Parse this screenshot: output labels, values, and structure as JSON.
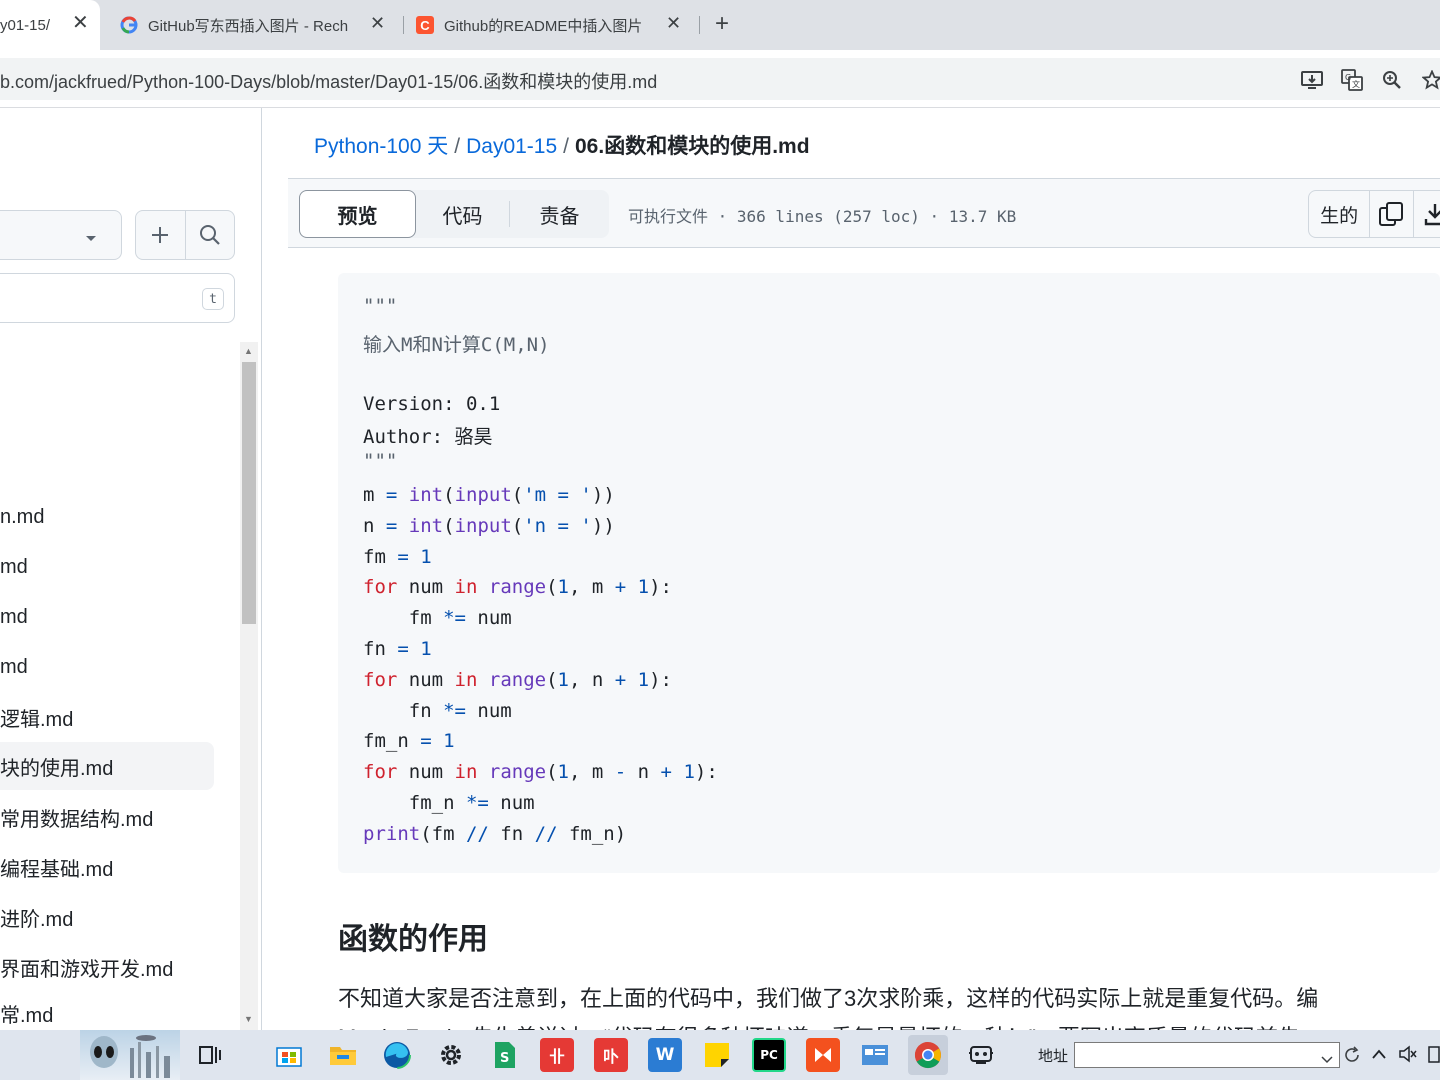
{
  "browser": {
    "tabs": [
      {
        "title": "y01-15/",
        "active": true
      },
      {
        "title": "GitHub写东西插入图片 - Rech",
        "active": false
      },
      {
        "title": "Github的README中插入图片",
        "active": false
      }
    ],
    "url": "b.com/jackfrued/Python-100-Days/blob/master/Day01-15/06.函数和模块的使用.md"
  },
  "sidebar": {
    "filter_shortcut": "t",
    "files": [
      "n.md",
      "md",
      "md",
      "md",
      "逻辑.md",
      "块的使用.md",
      "常用数据结构.md",
      "编程基础.md",
      "进阶.md",
      "界面和游戏开发.md",
      "常.md"
    ],
    "active_index": 5
  },
  "breadcrumb": {
    "repo": "Python-100 天",
    "folder": "Day01-15",
    "file": "06.函数和模块的使用.md",
    "sep": "/"
  },
  "file_header": {
    "tabs": [
      "预览",
      "代码",
      "责备"
    ],
    "meta": "可执行文件 · 366 lines (257 loc) · 13.7 KB",
    "raw_label": "生的"
  },
  "code_lines": [
    "\"\"\"",
    "输入M和N计算C(M,N)",
    "",
    "Version: 0.1",
    "Author: 骆昊",
    "\"\"\"",
    "m = int(input('m = '))",
    "n = int(input('n = '))",
    "fm = 1",
    "for num in range(1, m + 1):",
    "    fm *= num",
    "fn = 1",
    "for num in range(1, n + 1):",
    "    fn *= num",
    "fm_n = 1",
    "for num in range(1, m - n + 1):",
    "    fm_n *= num",
    "print(fm // fn // fm_n)"
  ],
  "content": {
    "heading": "函数的作用",
    "paragraph": "不知道大家是否注意到，在上面的代码中，我们做了3次求阶乘，这样的代码实际上就是重复代码。编",
    "paragraph_next": "Martin Fowler先生曾说过：“代码有很多种坏味道，重复是最坏的一种！”，要写出高质量的代码首先"
  },
  "taskbar": {
    "address_label": "地址",
    "apps": [
      "task-view",
      "store",
      "file-explorer",
      "edge",
      "settings",
      "sheets",
      "app-red-1",
      "app-red-2",
      "word",
      "sticky-notes",
      "pycharm",
      "app-orange",
      "app-blue",
      "chrome",
      "app-misc"
    ]
  }
}
